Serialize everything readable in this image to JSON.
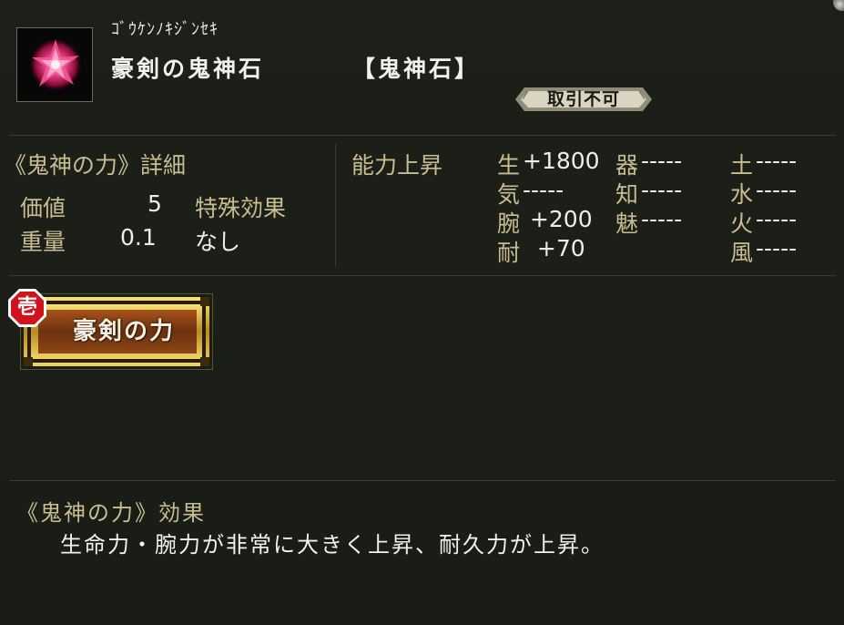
{
  "item": {
    "reading": "ｺﾞｳｹﾝﾉｷｼﾞﾝｾｷ",
    "name": "豪剣の鬼神石",
    "category": "【鬼神石】",
    "trade_status": "取引不可",
    "icon": "crystal-gem-icon"
  },
  "details": {
    "title": "《鬼神の力》詳細",
    "value_label": "価値",
    "value": "5",
    "weight_label": "重量",
    "weight": "0.1",
    "special_label": "特殊効果",
    "special_value": "なし"
  },
  "ability": {
    "title": "能力上昇",
    "stats": [
      {
        "label": "生",
        "value": "+1800"
      },
      {
        "label": "気",
        "value": "-----"
      },
      {
        "label": "腕",
        "value": " +200"
      },
      {
        "label": "耐",
        "value": "  +70"
      },
      {
        "label": "器",
        "value": "-----"
      },
      {
        "label": "知",
        "value": "-----"
      },
      {
        "label": "魅",
        "value": "-----"
      },
      {
        "label": "土",
        "value": "-----"
      },
      {
        "label": "水",
        "value": "-----"
      },
      {
        "label": "火",
        "value": "-----"
      },
      {
        "label": "風",
        "value": "-----"
      }
    ]
  },
  "skill": {
    "rank": "壱",
    "label": "豪剣の力"
  },
  "effect": {
    "title": "《鬼神の力》効果",
    "text": "生命力・腕力が非常に大きく上昇、耐久力が上昇。"
  },
  "colors": {
    "background": "#1b1d17",
    "label_gold": "#c8bc91",
    "text_white": "#eeeee8",
    "button_gold": "#c9a23a",
    "button_brown": "#7a3c10",
    "badge_red": "#d0141e"
  }
}
